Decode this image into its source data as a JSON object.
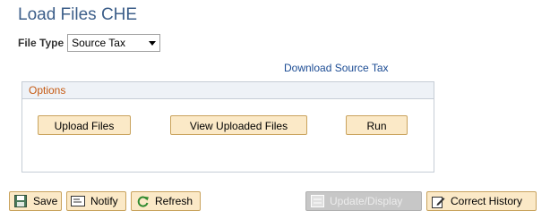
{
  "page": {
    "title": "Load Files CHE"
  },
  "file_type": {
    "label": "File Type",
    "selected": "Source Tax"
  },
  "links": {
    "download": "Download Source Tax"
  },
  "options": {
    "header": "Options",
    "buttons": {
      "upload": "Upload Files",
      "view": "View Uploaded Files",
      "run": "Run"
    }
  },
  "toolbar": {
    "save": "Save",
    "notify": "Notify",
    "refresh": "Refresh",
    "update_display": "Update/Display",
    "correct_history": "Correct History"
  },
  "colors": {
    "title": "#3d5f8a",
    "link": "#1c4c94",
    "options_header": "#c65a12",
    "button_bg": "#fbe9c7",
    "button_border": "#c9a35d",
    "disabled_bg": "#c7c7c7"
  },
  "icons": {
    "save": "floppy-disk-icon",
    "notify": "notify-icon",
    "refresh": "refresh-icon",
    "update_display": "update-display-icon",
    "correct_history": "correct-history-icon"
  }
}
